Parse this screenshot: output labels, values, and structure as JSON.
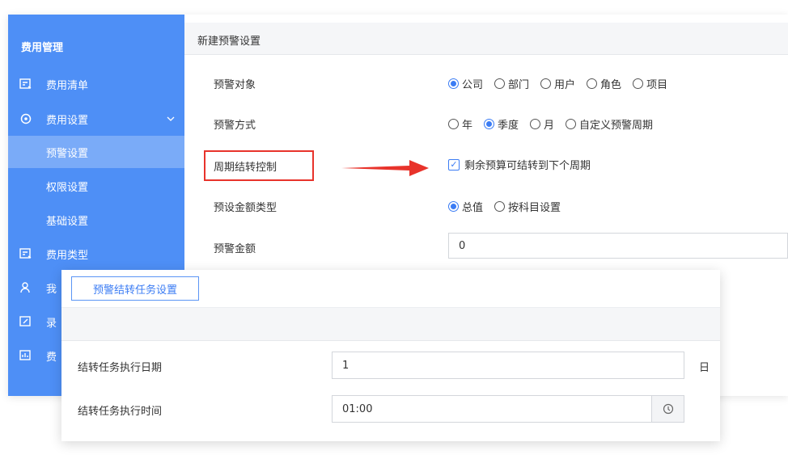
{
  "sidebar": {
    "title": "费用管理",
    "items": [
      {
        "label": "费用清单",
        "icon": "receipt-icon"
      },
      {
        "label": "费用设置",
        "icon": "settings-circle-icon"
      },
      {
        "label": "预警设置"
      },
      {
        "label": "权限设置"
      },
      {
        "label": "基础设置"
      },
      {
        "label": "费用类型",
        "icon": "expense-type-icon"
      },
      {
        "label": "我",
        "icon": "user-icon"
      },
      {
        "label": "录",
        "icon": "edit-icon"
      },
      {
        "label": "费",
        "icon": "chart-icon"
      }
    ]
  },
  "main": {
    "title": "新建预警设置",
    "rows": {
      "target": {
        "label": "预警对象",
        "options": [
          "公司",
          "部门",
          "用户",
          "角色",
          "项目"
        ],
        "selected": "公司"
      },
      "method": {
        "label": "预警方式",
        "options": [
          "年",
          "季度",
          "月",
          "自定义预警周期"
        ],
        "selected": "季度"
      },
      "rollover": {
        "label": "周期结转控制",
        "checkbox_label": "剩余预算可结转到下个周期",
        "checked": true
      },
      "amount_type": {
        "label": "预设金额类型",
        "options": [
          "总值",
          "按科目设置"
        ],
        "selected": "总值"
      },
      "amount": {
        "label": "预警金额",
        "value": "0"
      }
    }
  },
  "dialog": {
    "button_label": "预警结转任务设置",
    "date_label": "结转任务执行日期",
    "date_value": "1",
    "date_unit": "日",
    "time_label": "结转任务执行时间",
    "time_value": "01:00"
  },
  "colors": {
    "sidebar_bg": "#4e8ff6",
    "accent": "#3b7cf4",
    "highlight": "#e8332b"
  }
}
